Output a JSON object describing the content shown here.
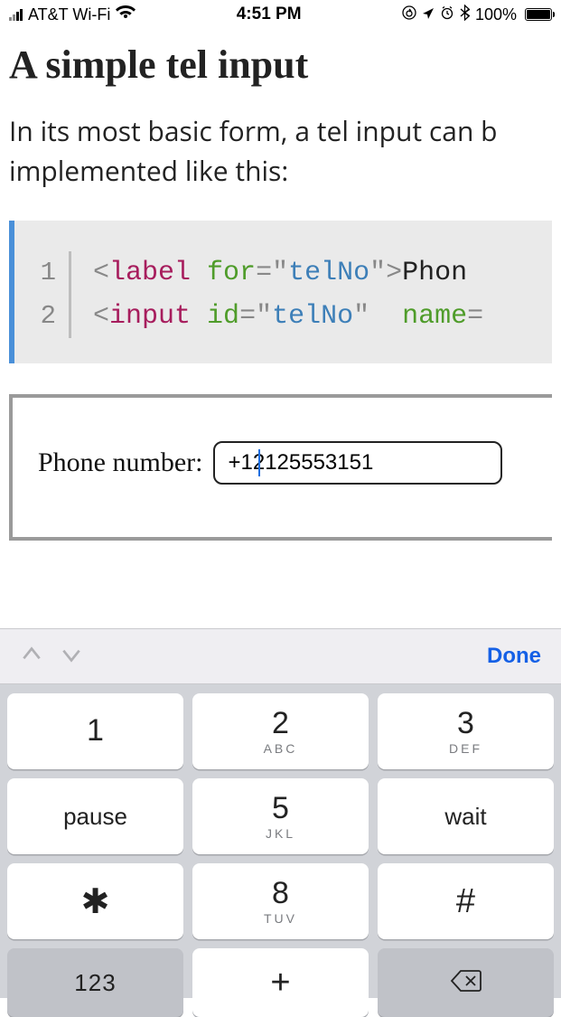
{
  "status_bar": {
    "carrier": "AT&T Wi-Fi",
    "signal_strength": 2,
    "time": "4:51 PM",
    "orientation_lock_icon": "rotation-lock",
    "location_icon": "location-arrow",
    "alarm_icon": "alarm-clock",
    "bluetooth_icon": "bluetooth",
    "battery_pct": "100%"
  },
  "page": {
    "title": "A simple tel input",
    "paragraph": "In its most basic form, a tel input can be implemented like this:"
  },
  "code": {
    "line1_no": "1",
    "line2_no": "2",
    "l1_open": "<",
    "l1_tag": "label",
    "l1_attr_for": "for",
    "l1_eq": "=",
    "l1_q": "\"",
    "l1_for_val": "telNo",
    "l1_close": ">",
    "l1_text": "Phon",
    "l2_open": "<",
    "l2_tag": "input",
    "l2_attr_id": "id",
    "l2_eq": "=",
    "l2_q": "\"",
    "l2_id_val": "telNo",
    "l2_attr_name": "name",
    "l2_eq2": "="
  },
  "demo": {
    "label": "Phone number:",
    "input_value": "+12125553151"
  },
  "keyboard": {
    "accessory": {
      "done": "Done"
    },
    "keys": {
      "k1": {
        "num": "1",
        "sub": ""
      },
      "k2": {
        "num": "2",
        "sub": "ABC"
      },
      "k3": {
        "num": "3",
        "sub": "DEF"
      },
      "pause": "pause",
      "k5": {
        "num": "5",
        "sub": "JKL"
      },
      "wait": "wait",
      "star": "✱",
      "k8": {
        "num": "8",
        "sub": "TUV"
      },
      "hash": "#",
      "abc": "123",
      "plus": "+",
      "backspace": "⌫"
    }
  }
}
